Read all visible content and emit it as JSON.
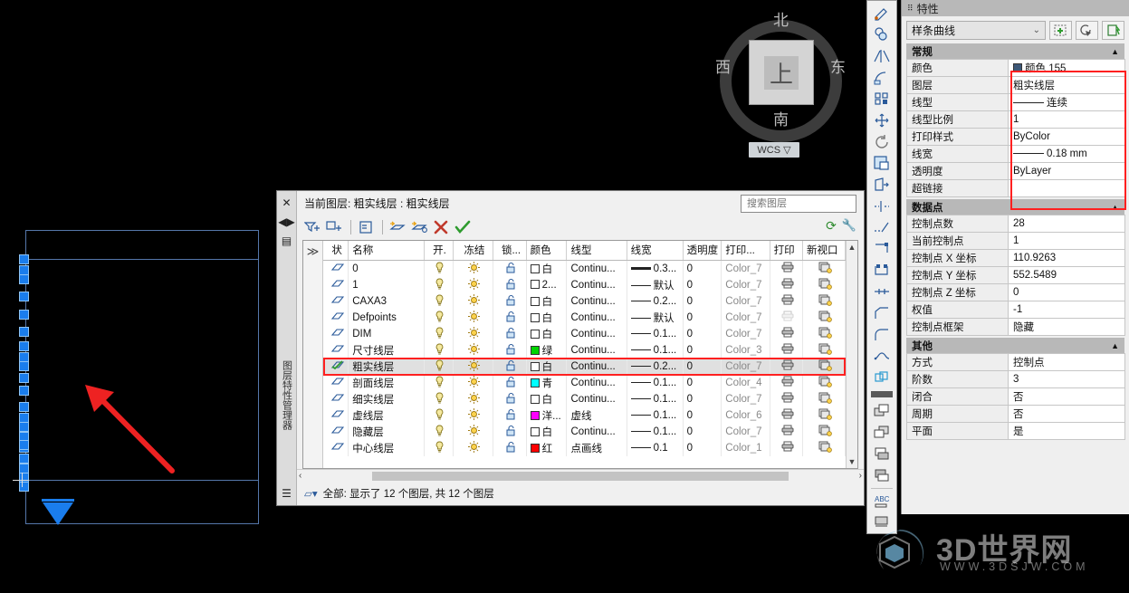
{
  "viewcube": {
    "north": "北",
    "south": "南",
    "west": "西",
    "east": "东",
    "face": "上",
    "wcs_label": "WCS",
    "wcs_caret": "▽"
  },
  "layer_dialog": {
    "vertical_title": "图层特性管理器",
    "current_layer_text": "当前图层: 粗实线层 : 粗实线层",
    "search_placeholder": "搜索图层",
    "toolbar": [
      {
        "name": "new-layer-filter-icon",
        "glyph": "▱"
      },
      {
        "name": "new-group-filter-icon",
        "glyph": "▤"
      },
      {
        "name": "layer-states-manager-icon",
        "glyph": "▥"
      },
      {
        "name": "new-layer-icon",
        "glyph": "◪"
      },
      {
        "name": "new-layer-vp-frozen-icon",
        "glyph": "◫"
      },
      {
        "name": "delete-layer-icon",
        "glyph": "✕"
      },
      {
        "name": "set-current-icon",
        "glyph": "✔"
      }
    ],
    "right_icons": [
      {
        "name": "refresh-icon",
        "glyph": "⟳"
      },
      {
        "name": "settings-wrench-icon",
        "glyph": "🔧"
      }
    ],
    "tree_toggle": "≫",
    "columns": [
      "状",
      "名称",
      "开.",
      "冻结",
      "锁...",
      "颜色",
      "线型",
      "线宽",
      "透明度",
      "打印...",
      "打印",
      "新视口"
    ],
    "rows": [
      {
        "name": "0",
        "color_name": "白",
        "color_hex": "#ffffff",
        "linetype": "Continu...",
        "lineweight": "0.3...",
        "lw_thick": true,
        "transparency": "0",
        "plotstyle": "Color_7",
        "plot": true,
        "selected": false
      },
      {
        "name": "1",
        "color_name": "2...",
        "color_hex": "#ffffff",
        "linetype": "Continu...",
        "lineweight": "默认",
        "lw_thick": false,
        "transparency": "0",
        "plotstyle": "Color_7",
        "plot": true,
        "selected": false
      },
      {
        "name": "CAXA3",
        "color_name": "白",
        "color_hex": "#ffffff",
        "linetype": "Continu...",
        "lineweight": "0.2...",
        "lw_thick": false,
        "transparency": "0",
        "plotstyle": "Color_7",
        "plot": true,
        "selected": false
      },
      {
        "name": "Defpoints",
        "color_name": "白",
        "color_hex": "#ffffff",
        "linetype": "Continu...",
        "lineweight": "默认",
        "lw_thick": false,
        "transparency": "0",
        "plotstyle": "Color_7",
        "plot": false,
        "selected": false
      },
      {
        "name": "DIM",
        "color_name": "白",
        "color_hex": "#ffffff",
        "linetype": "Continu...",
        "lineweight": "0.1...",
        "lw_thick": false,
        "transparency": "0",
        "plotstyle": "Color_7",
        "plot": true,
        "selected": false
      },
      {
        "name": "尺寸线层",
        "color_name": "绿",
        "color_hex": "#00d400",
        "linetype": "Continu...",
        "lineweight": "0.1...",
        "lw_thick": false,
        "transparency": "0",
        "plotstyle": "Color_3",
        "plot": true,
        "selected": false
      },
      {
        "name": "粗实线层",
        "color_name": "白",
        "color_hex": "#ffffff",
        "linetype": "Continu...",
        "lineweight": "0.2...",
        "lw_thick": false,
        "transparency": "0",
        "plotstyle": "Color_7",
        "plot": true,
        "selected": true
      },
      {
        "name": "剖面线层",
        "color_name": "青",
        "color_hex": "#00ffff",
        "linetype": "Continu...",
        "lineweight": "0.1...",
        "lw_thick": false,
        "transparency": "0",
        "plotstyle": "Color_4",
        "plot": true,
        "selected": false
      },
      {
        "name": "细实线层",
        "color_name": "白",
        "color_hex": "#ffffff",
        "linetype": "Continu...",
        "lineweight": "0.1...",
        "lw_thick": false,
        "transparency": "0",
        "plotstyle": "Color_7",
        "plot": true,
        "selected": false
      },
      {
        "name": "虚线层",
        "color_name": "洋...",
        "color_hex": "#ff00ff",
        "linetype": "虚线",
        "lineweight": "0.1...",
        "lw_thick": false,
        "transparency": "0",
        "plotstyle": "Color_6",
        "plot": true,
        "selected": false
      },
      {
        "name": "隐藏层",
        "color_name": "白",
        "color_hex": "#ffffff",
        "linetype": "Continu...",
        "lineweight": "0.1...",
        "lw_thick": false,
        "transparency": "0",
        "plotstyle": "Color_7",
        "plot": true,
        "selected": false
      },
      {
        "name": "中心线层",
        "color_name": "红",
        "color_hex": "#ff0000",
        "linetype": "点画线",
        "lineweight": "0.1",
        "lw_thick": false,
        "transparency": "0",
        "plotstyle": "Color_1",
        "plot": true,
        "selected": false
      }
    ],
    "status_text": "全部: 显示了 12 个图层, 共 12 个图层"
  },
  "properties": {
    "title": "特性",
    "object_type": "样条曲线",
    "buttons": [
      {
        "name": "quick-select-icon",
        "glyph": "⊞"
      },
      {
        "name": "select-objects-icon",
        "glyph": "⟳"
      },
      {
        "name": "quick-calc-icon",
        "glyph": "⚡"
      }
    ],
    "sections": [
      {
        "title": "常规",
        "collapse_glyph": "▲",
        "rows": [
          {
            "key": "颜色",
            "value": "颜色 155",
            "swatch": "#3d5878"
          },
          {
            "key": "图层",
            "value": "粗实线层"
          },
          {
            "key": "线型",
            "value": "连续",
            "line": true
          },
          {
            "key": "线型比例",
            "value": "1"
          },
          {
            "key": "打印样式",
            "value": "ByColor"
          },
          {
            "key": "线宽",
            "value": "0.18 mm",
            "line": true
          },
          {
            "key": "透明度",
            "value": "ByLayer"
          },
          {
            "key": "超链接",
            "value": ""
          }
        ]
      },
      {
        "title": "数据点",
        "collapse_glyph": "▲",
        "rows": [
          {
            "key": "控制点数",
            "value": "28"
          },
          {
            "key": "当前控制点",
            "value": "1"
          },
          {
            "key": "控制点 X 坐标",
            "value": "110.9263"
          },
          {
            "key": "控制点 Y 坐标",
            "value": "552.5489"
          },
          {
            "key": "控制点 Z 坐标",
            "value": "0"
          },
          {
            "key": "权值",
            "value": "-1"
          },
          {
            "key": "控制点框架",
            "value": "隐藏"
          }
        ]
      },
      {
        "title": "其他",
        "collapse_glyph": "▲",
        "rows": [
          {
            "key": "方式",
            "value": "控制点"
          },
          {
            "key": "阶数",
            "value": "3"
          },
          {
            "key": "闭合",
            "value": "否"
          },
          {
            "key": "周期",
            "value": "否"
          },
          {
            "key": "平面",
            "value": "是"
          }
        ]
      }
    ]
  },
  "watermark": {
    "text": "3D世界网",
    "sub": "WWW.3DSJW.COM"
  },
  "canvas": {
    "grip_color": "#1a7ded",
    "outline_color": "#5577aa",
    "annotation_arrow_color": "#ee2222"
  }
}
